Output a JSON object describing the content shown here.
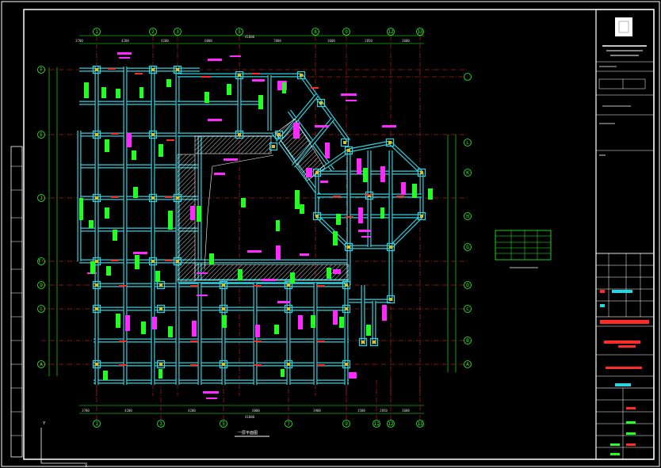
{
  "drawing": {
    "title": "一层平面图",
    "colors": {
      "background": "#000000",
      "frame": "#ffffff",
      "beam": "#2ad4e0",
      "column": "#e0c020",
      "axis": "#22ff22",
      "annotation_magenta": "#ff2aff",
      "annotation_green": "#22ff22",
      "centerline": "#ff2a2a",
      "hatch": "#ffffff"
    },
    "axes_top": [
      "1",
      "2",
      "3",
      "5",
      "8",
      "9",
      "12",
      "13"
    ],
    "axes_bottom": [
      "1",
      "3",
      "5",
      "7",
      "9",
      "11",
      "12",
      "13"
    ],
    "axes_left": [
      "F",
      "E",
      "J",
      "F'",
      "D",
      "C",
      "B",
      "A"
    ],
    "axes_right": [
      "L",
      "K",
      "H",
      "G",
      "D",
      "C",
      "B",
      "A"
    ],
    "dims_top": [
      "3700",
      "4200",
      "4200",
      "6000",
      "7000",
      "3600",
      "2850",
      "3600"
    ],
    "dims_bottom": [
      "3700",
      "4200",
      "4200",
      "6000",
      "3900",
      "3500",
      "2850",
      "3600"
    ],
    "overall_dim": "41000",
    "coordinate_icon": {
      "y_label": "Y",
      "x_label": "X"
    }
  },
  "title_block": {
    "rows": 22
  },
  "legend_table": {
    "rows": 5,
    "cols": 4
  }
}
